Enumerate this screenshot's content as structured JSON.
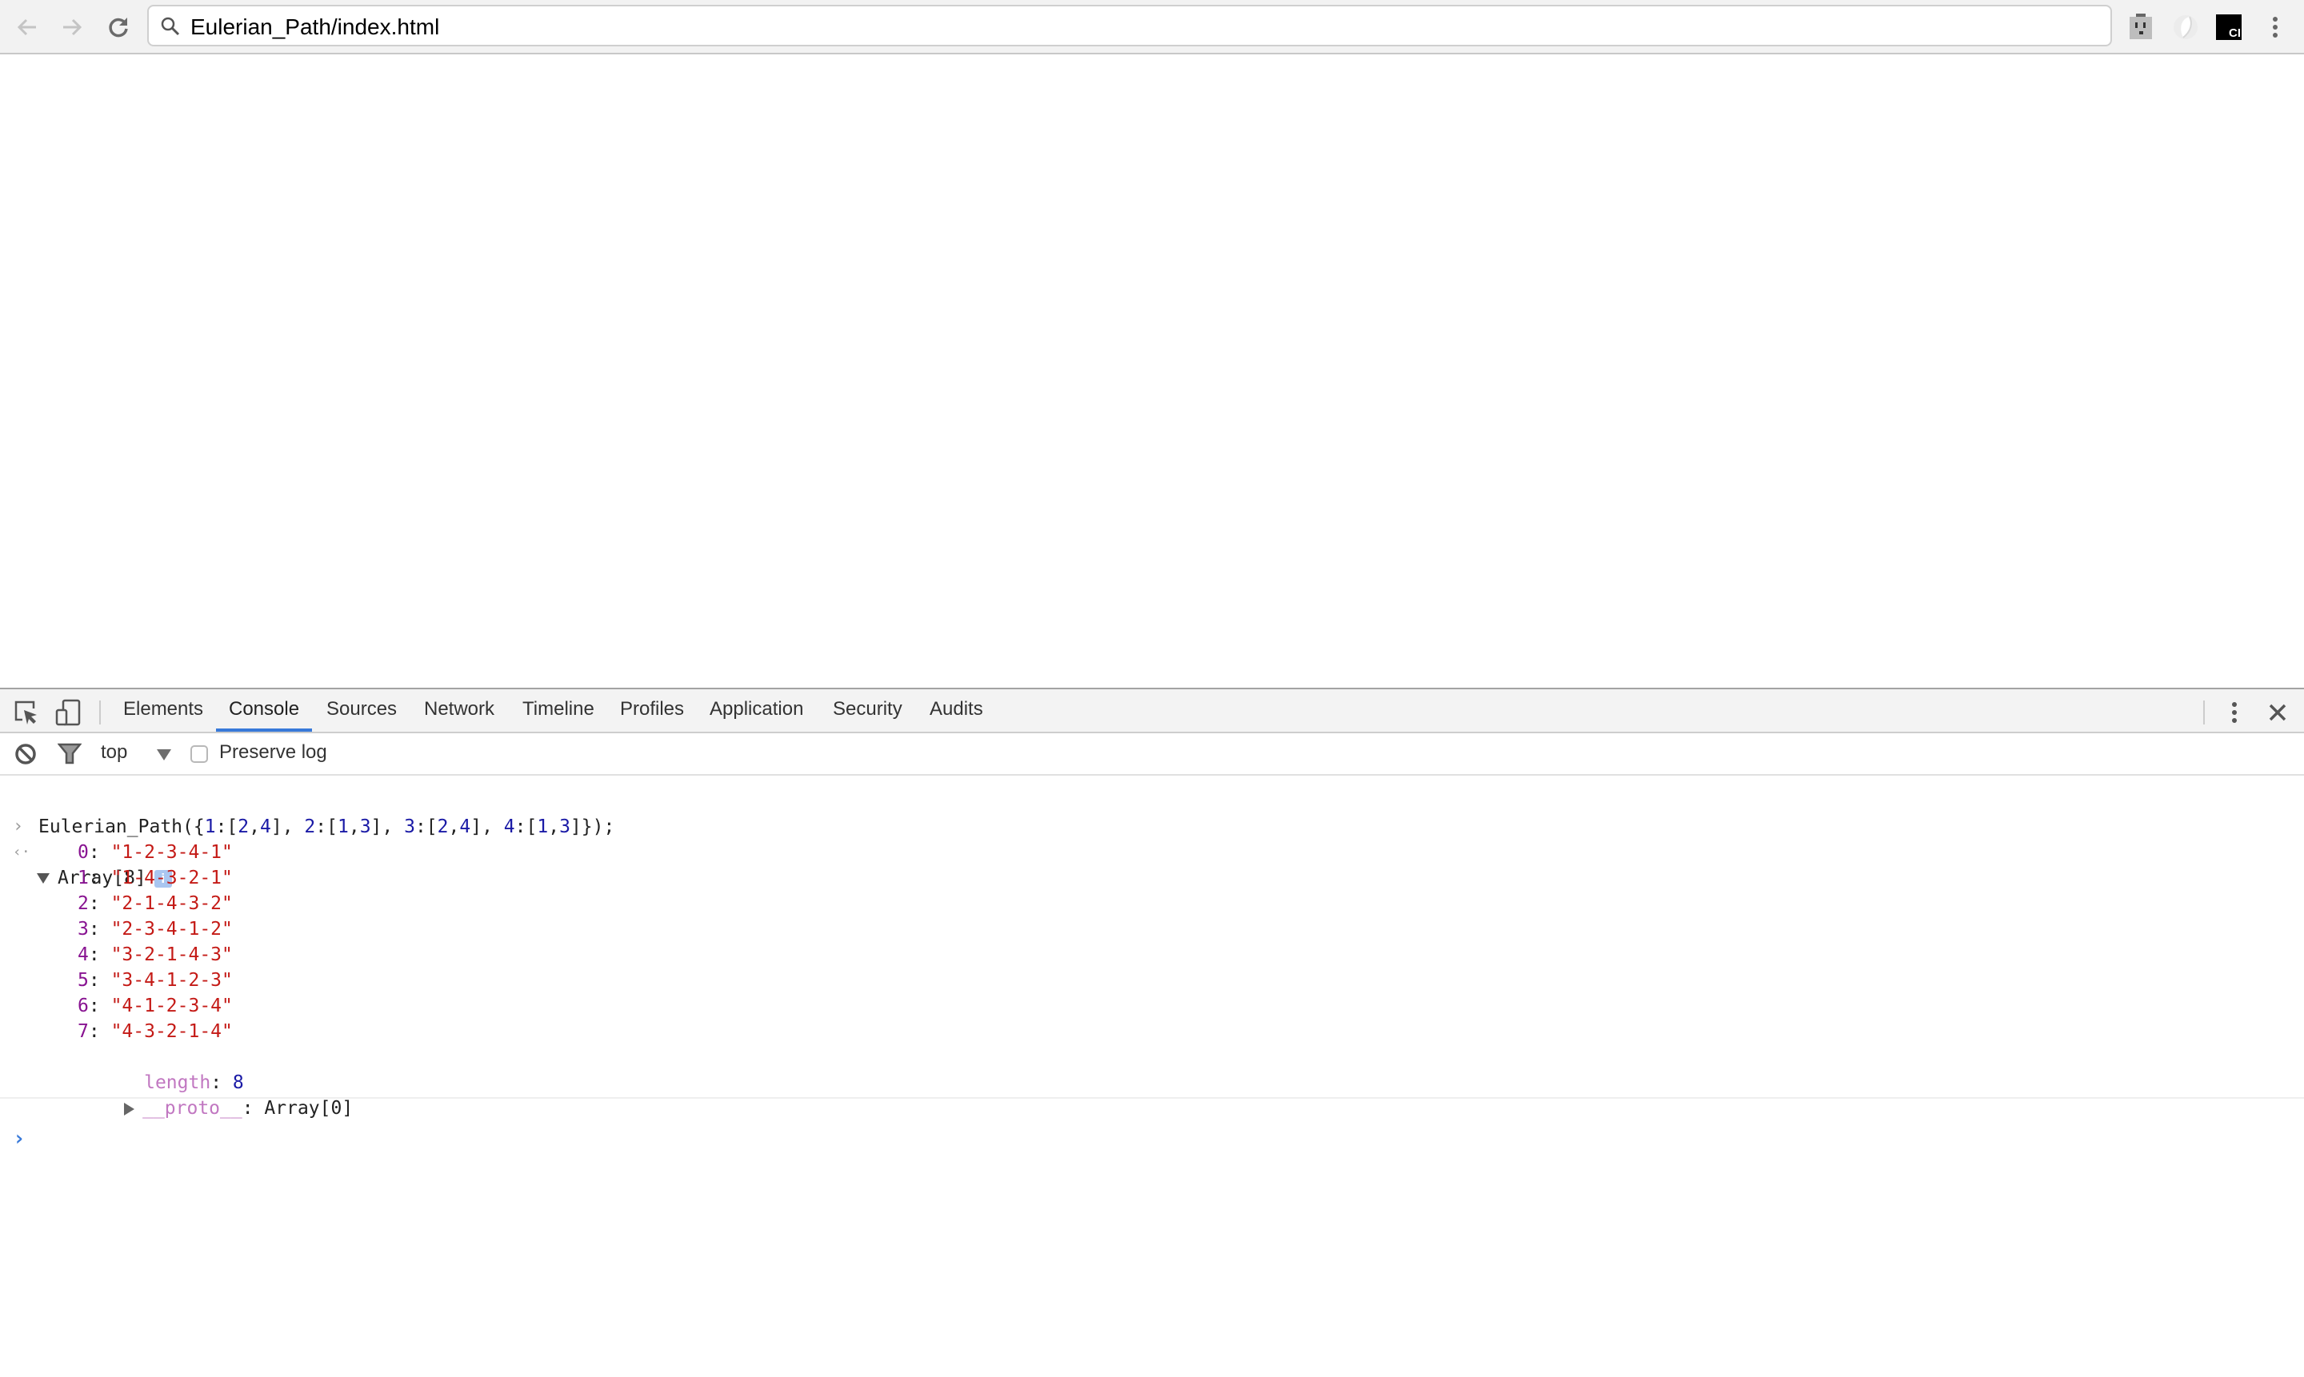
{
  "browser": {
    "url": "Eulerian_Path/index.html",
    "nav": {
      "back": "back-arrow",
      "forward": "forward-arrow",
      "reload": "reload"
    },
    "extensions": [
      "power-outlet-extension",
      "swirl-extension",
      "ci-extension"
    ],
    "ci_label": "CI"
  },
  "devtools": {
    "tabs": [
      {
        "label": "Elements"
      },
      {
        "label": "Console",
        "active": true
      },
      {
        "label": "Sources"
      },
      {
        "label": "Network"
      },
      {
        "label": "Timeline"
      },
      {
        "label": "Profiles"
      },
      {
        "label": "Application"
      },
      {
        "label": "Security"
      },
      {
        "label": "Audits"
      }
    ],
    "filter": {
      "context": "top",
      "preserve_log_label": "Preserve log",
      "preserve_log_checked": false
    },
    "console": {
      "input": {
        "fn": "Eulerian_Path",
        "open": "({",
        "pairs": [
          {
            "key": "1",
            "a": "2",
            "b": "4"
          },
          {
            "key": "2",
            "a": "1",
            "b": "3"
          },
          {
            "key": "3",
            "a": "2",
            "b": "4"
          },
          {
            "key": "4",
            "a": "1",
            "b": "3"
          }
        ],
        "close": "});"
      },
      "result": {
        "label": "Array[8]",
        "info_icon": "i",
        "items": [
          {
            "index": "0",
            "value": "\"1-2-3-4-1\""
          },
          {
            "index": "1",
            "value": "\"1-4-3-2-1\""
          },
          {
            "index": "2",
            "value": "\"2-1-4-3-2\""
          },
          {
            "index": "3",
            "value": "\"2-3-4-1-2\""
          },
          {
            "index": "4",
            "value": "\"3-2-1-4-3\""
          },
          {
            "index": "5",
            "value": "\"3-4-1-2-3\""
          },
          {
            "index": "6",
            "value": "\"4-1-2-3-4\""
          },
          {
            "index": "7",
            "value": "\"4-3-2-1-4\""
          }
        ],
        "length_key": "length",
        "length_value": "8",
        "proto_key": "__proto__",
        "proto_value": "Array[0]"
      }
    }
  }
}
